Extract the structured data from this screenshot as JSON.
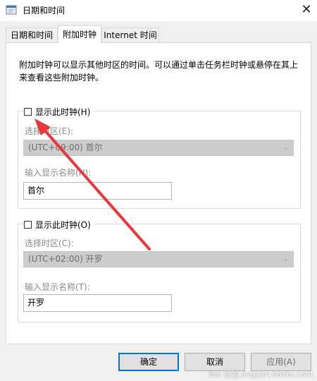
{
  "window": {
    "title": "日期和时间"
  },
  "tabs": [
    {
      "label": "日期和时间"
    },
    {
      "label": "附加时钟"
    },
    {
      "label": "Internet 时间"
    }
  ],
  "description": "附加时钟可以显示其他时区的时间。可以通过单击任务栏时钟或悬停在其上来查看这些附加时钟。",
  "clock1": {
    "checkbox_label": "显示此时钟(H)",
    "checked": false,
    "timezone_label": "选择时区(E):",
    "timezone_value": "(UTC+09:00) 首尔",
    "name_label": "输入显示名称(N):",
    "name_value": "首尔"
  },
  "clock2": {
    "checkbox_label": "显示此时钟(O)",
    "checked": false,
    "timezone_label": "选择时区(C):",
    "timezone_value": "(UTC+02:00) 开罗",
    "name_label": "输入显示名称(T):",
    "name_value": "开罗"
  },
  "buttons": {
    "ok": "确定",
    "cancel": "取消",
    "apply": "应用(A)"
  },
  "watermark": "Bai 经验 jingyan.baidu.com",
  "colors": {
    "annotation_arrow": "#e8383d",
    "focus_border": "#0078d7",
    "disabled_fill": "#cccccc"
  }
}
